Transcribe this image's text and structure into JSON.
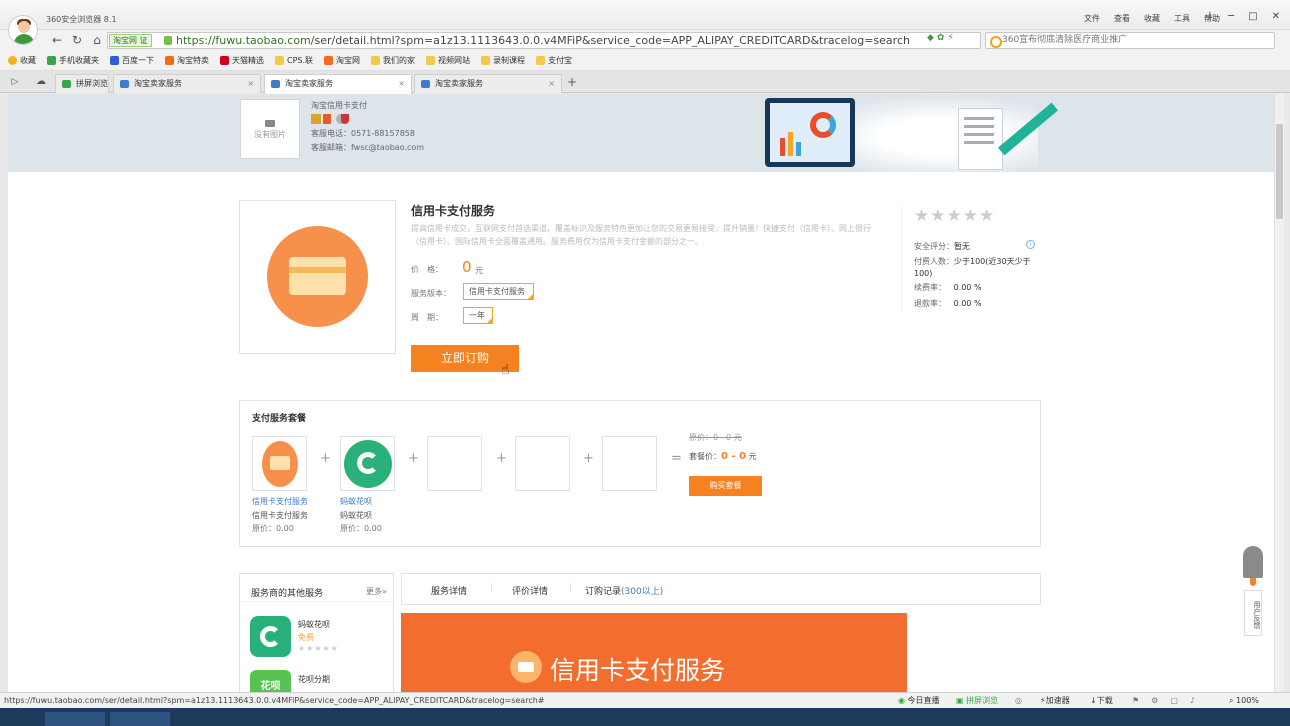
{
  "browser": {
    "title": "360安全浏览器 8.1",
    "menu": [
      "文件",
      "查看",
      "收藏",
      "工具",
      "帮助"
    ],
    "window_buttons": [
      "↓",
      "□",
      "─",
      "✕"
    ],
    "site_badge": "淘宝网 证",
    "url_domain": "https://fuwu.taobao.com",
    "url_path": "/ser/detail.html?spm=a1z13.1113643.0.0.v4MFiP&service_code=APP_ALIPAY_CREDITCARD&tracelog=search",
    "search_placeholder": "360宣布彻底清除医疗商业推广",
    "bookmarks": [
      "收藏",
      "手机收藏夹",
      "百度一下",
      "淘宝特卖",
      "天猫精选",
      "CPS.联",
      "淘宝网",
      "我们的家",
      "视频网站",
      "录制课程",
      "支付宝"
    ],
    "tabs": [
      "拼屏浏览",
      "淘宝卖家服务",
      "淘宝卖家服务",
      "淘宝卖家服务"
    ],
    "new_tab": "+"
  },
  "banner": {
    "no_image": "没有图片",
    "provider_name": "淘宝信用卡支付",
    "phone_label": "客服电话：",
    "phone": "0571-88157858",
    "email_label": "客服邮箱：",
    "email": "fwsc@taobao.com"
  },
  "product": {
    "title": "信用卡支付服务",
    "description": "提高信用卡成交，互联网支付首选渠道。覆盖标识及服务特色更加让您的交易更易接受，提升销量！快捷支付（信用卡）、网上银行（信用卡）、国际信用卡全面覆盖通用。服务费用仅为信用卡支付金额的部分之一。",
    "price_label": "价　格：",
    "price": "0",
    "price_unit": "元",
    "version_label": "服务版本：",
    "version": "信用卡支付服务",
    "period_label": "周　期：",
    "period": "一年",
    "buy_button": "立即订购"
  },
  "rating": {
    "stars": "★★★★★",
    "safety_label": "安全评分：",
    "safety_value": "暂无",
    "buyers_label": "付费人数：",
    "buyers_value": "少于100(近30天少于100)",
    "renew_label": "续费率：",
    "renew_value": "0.00 %",
    "refund_label": "退款率：",
    "refund_value": "0.00 %"
  },
  "package": {
    "title": "支付服务套餐",
    "items": [
      {
        "link": "信用卡支付服务",
        "name": "信用卡支付服务",
        "price": "原价：0.00"
      },
      {
        "link": "蚂蚁花呗",
        "name": "蚂蚁花呗",
        "price": "原价：0.00"
      }
    ],
    "orig_price": "原价：0 - 0 元",
    "pkg_price_label": "套餐价：",
    "pkg_price": "0 - 0",
    "pkg_price_unit": "元",
    "buy_button": "购买套餐"
  },
  "sidebar": {
    "title": "服务商的其他服务",
    "more": "更多»",
    "items": [
      {
        "name": "蚂蚁花呗",
        "price": "免费",
        "stars": "★★★★★"
      },
      {
        "name": "花呗分期",
        "badge": "花呗"
      }
    ]
  },
  "detail_tabs": {
    "items": [
      "服务详情",
      "评价详情",
      "订购记录"
    ],
    "count": "(300以上)"
  },
  "detail_banner": {
    "text": "信用卡支付服务"
  },
  "feedback": "用户反馈",
  "statusbar": {
    "url": "https://fuwu.taobao.com/ser/detail.html?spm=a1z13.1113643.0.0.v4MFiP&service_code=APP_ALIPAY_CREDITCARD&tracelog=search#",
    "items": [
      "今日直播",
      "拼屏浏览",
      "加速器",
      "下载"
    ],
    "zoom": "100%"
  },
  "colors": {
    "accent": "#f5821f",
    "link": "#3b7cc4",
    "green": "#2ab07a"
  }
}
